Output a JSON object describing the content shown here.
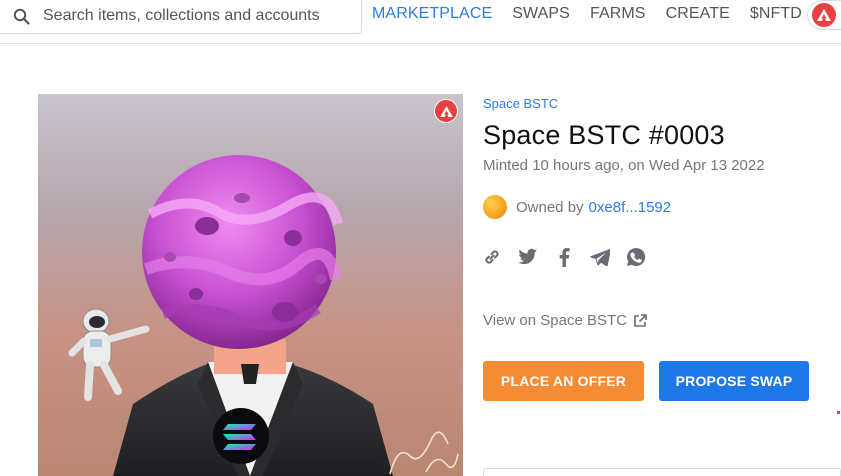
{
  "search": {
    "placeholder": "Search items, collections and accounts",
    "icon": "search-icon"
  },
  "nav": {
    "items": [
      {
        "label": "MARKETPLACE",
        "active": true
      },
      {
        "label": "SWAPS",
        "active": false
      },
      {
        "label": "FARMS",
        "active": false
      },
      {
        "label": "CREATE",
        "active": false
      },
      {
        "label": "$NFTD",
        "active": false
      }
    ],
    "network_icon": "avalanche-icon"
  },
  "item": {
    "collection": "Space BSTC",
    "title": "Space BSTC #0003",
    "minted": "Minted 10 hours ago, on Wed Apr 13 2022",
    "owned_by_label": "Owned by",
    "owner_address": "0xe8f...1592",
    "view_on_label": "View on Space BSTC",
    "share_icons": [
      "link-icon",
      "twitter-icon",
      "facebook-icon",
      "telegram-icon",
      "whatsapp-icon"
    ],
    "chain_icon": "avalanche-icon"
  },
  "actions": {
    "offer_label": "PLACE AN OFFER",
    "swap_label": "PROPOSE SWAP"
  },
  "colors": {
    "accent_blue": "#2b7ce9",
    "offer_orange": "#f48c36",
    "swap_blue": "#1e78e8",
    "avalanche_red": "#e84142",
    "planet_purple": "#c64fd0"
  }
}
